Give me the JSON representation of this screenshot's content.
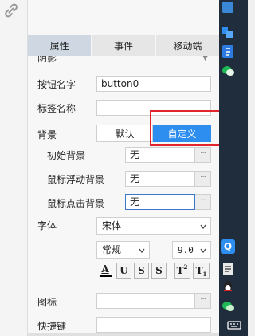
{
  "tabs": [
    {
      "label": "属性",
      "active": true
    },
    {
      "label": "事件",
      "active": false
    },
    {
      "label": "移动端",
      "active": false
    }
  ],
  "clipped_row_label": "阴影",
  "button_name": {
    "label": "按钮名字",
    "value": "button0"
  },
  "tag_name": {
    "label": "标签名称",
    "value": ""
  },
  "background": {
    "label": "背景",
    "options": [
      "默认",
      "自定义"
    ],
    "selected": "自定义",
    "initial": {
      "label": "初始背景",
      "value": "无"
    },
    "hover": {
      "label": "鼠标浮动背景",
      "value": "无"
    },
    "click": {
      "label": "鼠标点击背景",
      "value": "无"
    }
  },
  "font": {
    "label": "字体",
    "family": "宋体",
    "style": "常规",
    "size": "9.0",
    "buttons": {
      "color": "A",
      "underline": "U",
      "strike": "S",
      "shadow": "S",
      "superscript": "T",
      "subscript": "T",
      "sup_mark": "2",
      "sub_mark": "1"
    }
  },
  "icon": {
    "label": "图标",
    "value": ""
  },
  "shortcut": {
    "label": "快捷键",
    "value": ""
  },
  "colors": {
    "accent": "#2d8ef0",
    "highlight_box": "#e0262c",
    "active_tab": "#cfd8e2",
    "taskbar": "#1f2d3d"
  },
  "taskbar_icons": [
    "pinned-app-icon",
    "blue-app-icon",
    "wechat-icon",
    "qq-icon",
    "document-icon",
    "qq-penguin-icon",
    "wechat-icon",
    "keyboard-icon"
  ]
}
